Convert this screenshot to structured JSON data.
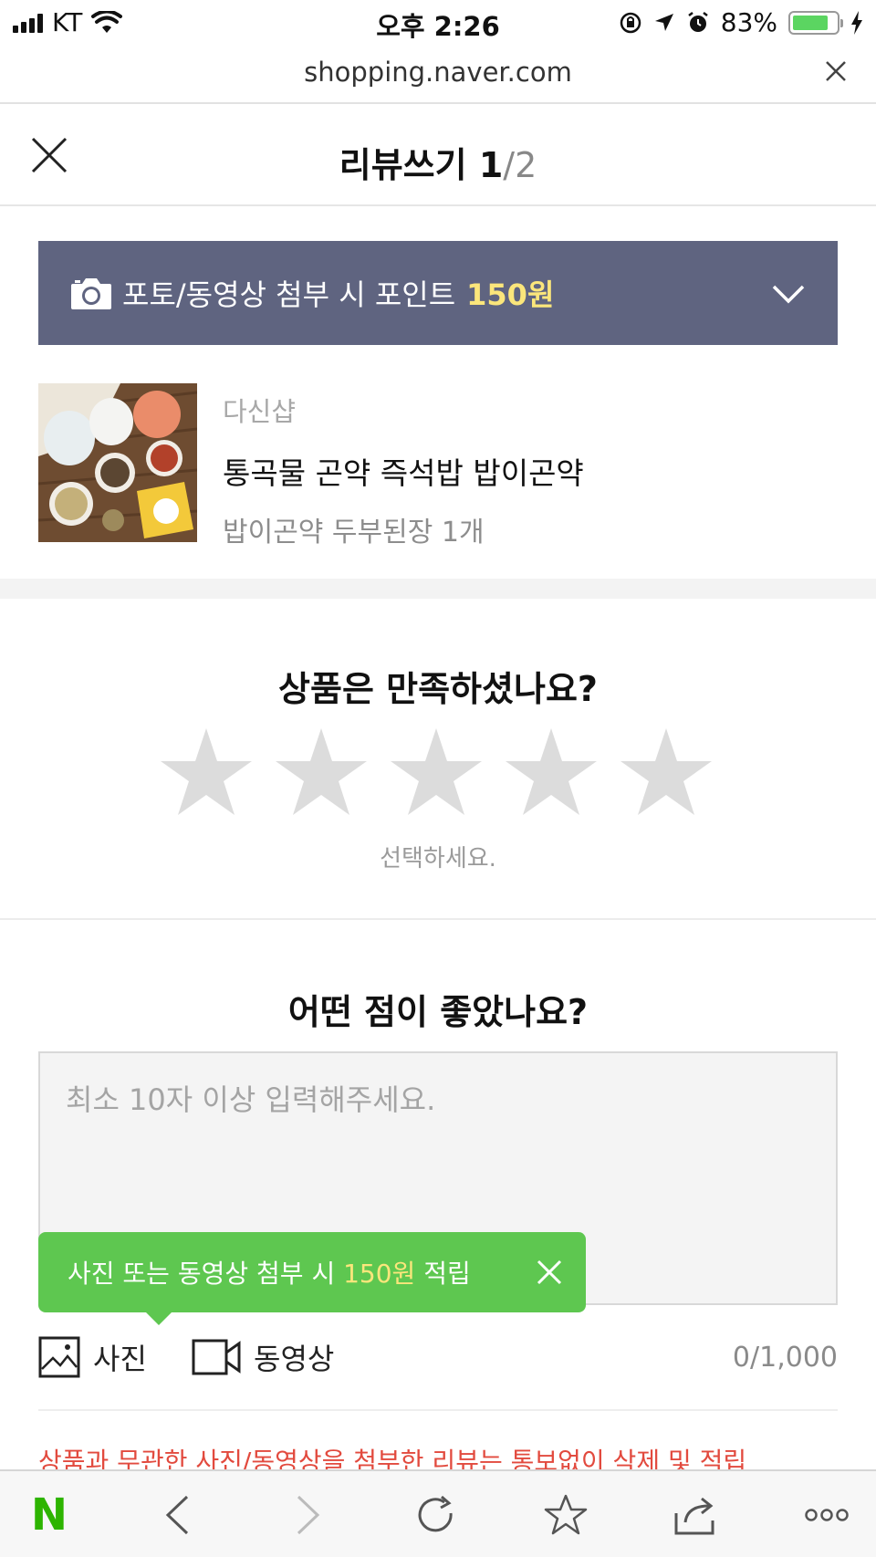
{
  "status_bar": {
    "carrier": "KT",
    "time": "오후 2:26",
    "battery": "83%",
    "battery_level": 0.83
  },
  "browser": {
    "url": "shopping.naver.com"
  },
  "header": {
    "title": "리뷰쓰기",
    "step_current": "1",
    "step_total": "/2"
  },
  "banner": {
    "text": "포토/동영상 첨부 시 포인트",
    "amount": "150원"
  },
  "product": {
    "shop": "다신샵",
    "name": "통곡물 곤약 즉석밥 밥이곤약",
    "option": "밥이곤약 두부된장 1개"
  },
  "rating": {
    "question": "상품은 만족하셨나요?",
    "hint": "선택하세요.",
    "max_stars": 5,
    "selected": 0,
    "star_color": "#dcdcdc"
  },
  "review": {
    "question": "어떤 점이 좋았나요?",
    "placeholder": "최소 10자 이상 입력해주세요.",
    "value": ""
  },
  "tooltip": {
    "text_before": "사진 또는 동영상 첨부 시",
    "amount": "150원",
    "text_after": "적립"
  },
  "attach": {
    "photo_label": "사진",
    "video_label": "동영상",
    "counter": "0/1,000"
  },
  "warning": "상품과 무관한 사진/동영상을 첨부한 리뷰는 통보없이 삭제 및 적립",
  "toolbar": {
    "logo": "N"
  },
  "colors": {
    "banner_bg": "#5f6480",
    "highlight": "#fbe67b",
    "tooltip_bg": "#5ec750",
    "warning": "#e24a3e",
    "naver_green": "#2db400"
  }
}
